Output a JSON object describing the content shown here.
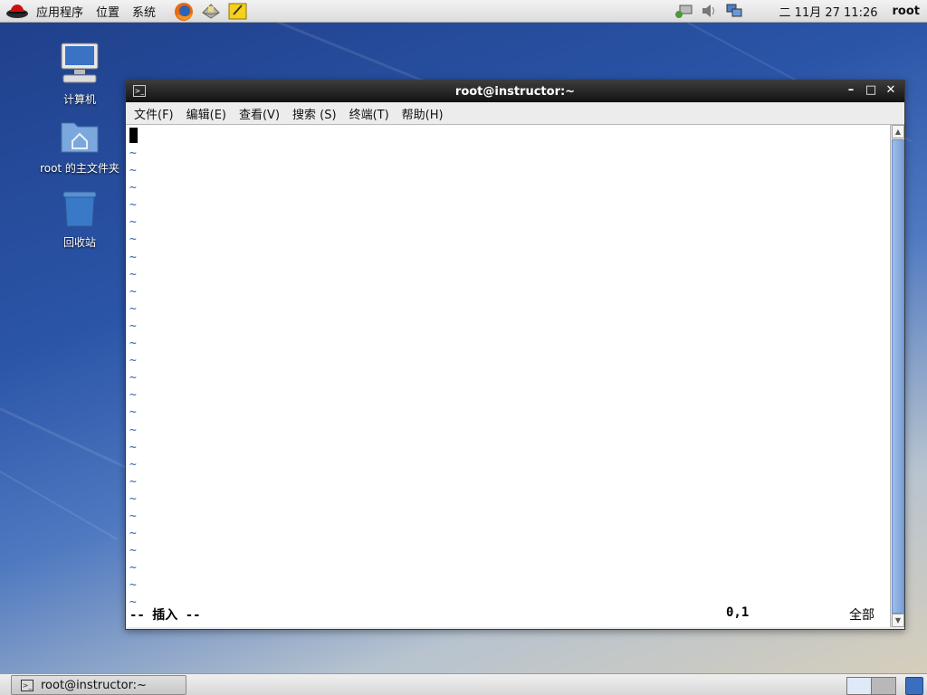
{
  "top_panel": {
    "menus": [
      "应用程序",
      "位置",
      "系统"
    ],
    "launchers": [
      "firefox-icon",
      "mail-icon",
      "notes-icon"
    ],
    "tray_icons": [
      "network-icon",
      "volume-icon",
      "display-icon"
    ],
    "clock": "二 11月 27 11:26",
    "user": "root"
  },
  "desktop_icons": [
    {
      "label": "计算机",
      "icon": "computer-icon"
    },
    {
      "label": "root 的主文件夹",
      "icon": "home-folder-icon"
    },
    {
      "label": "回收站",
      "icon": "trash-icon"
    }
  ],
  "window": {
    "title": "root@instructor:~",
    "menus": [
      "文件(F)",
      "编辑(E)",
      "查看(V)",
      "搜索 (S)",
      "终端(T)",
      "帮助(H)"
    ],
    "editor": {
      "tilde": "~",
      "tilde_count": 27,
      "mode": "-- 插入 --",
      "position": "0,1",
      "scroll": "全部"
    }
  },
  "taskbar": {
    "task_label": "root@instructor:~"
  },
  "colors": {
    "tilde": "#2a5fb0",
    "scroll_thumb": "#7aa0d8",
    "titlebar": "#121212"
  }
}
